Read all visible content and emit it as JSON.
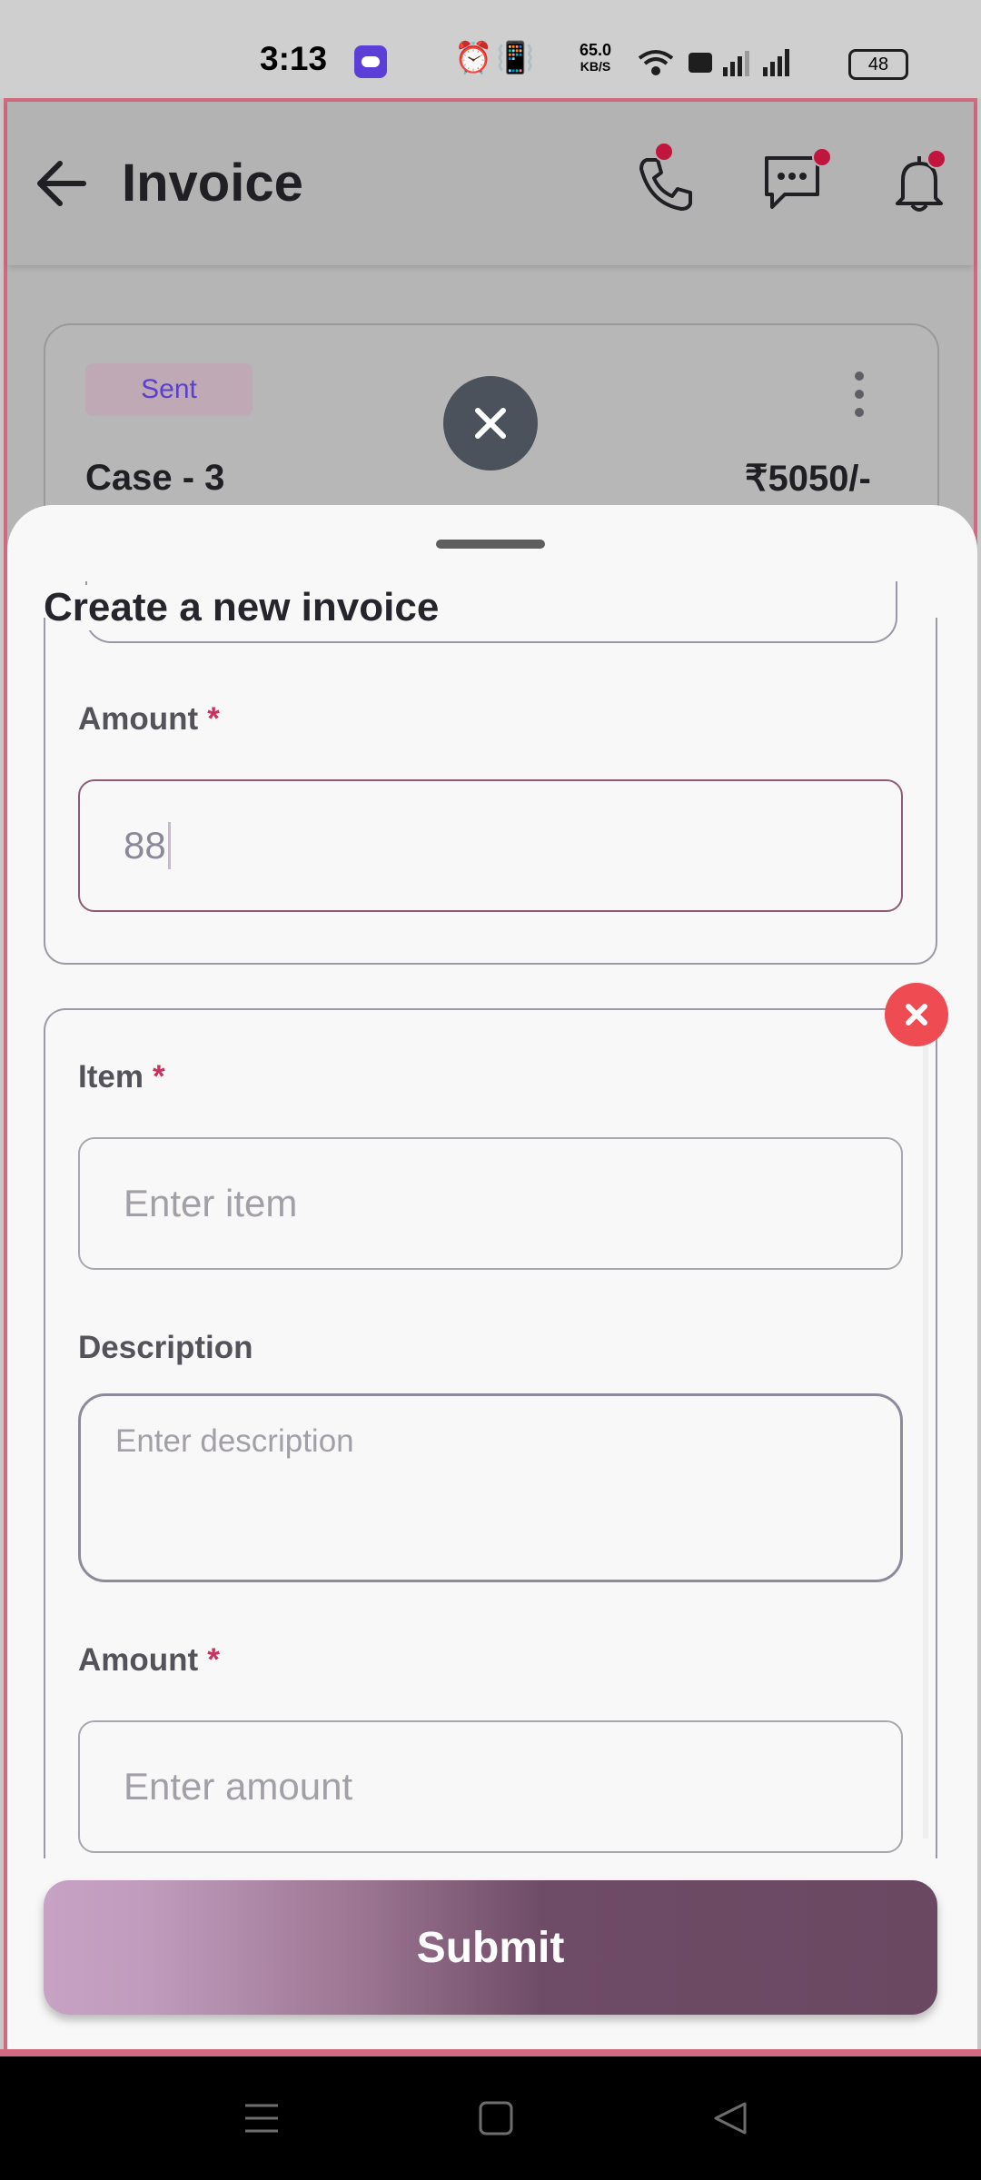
{
  "status_bar": {
    "time": "3:13",
    "speed_value": "65.0",
    "speed_unit": "KB/S",
    "battery": "48",
    "icons": [
      "alarm-icon",
      "vibrate-icon",
      "bluetooth-icon",
      "wifi-icon",
      "wifi-calling-icon",
      "signal-icon",
      "signal-icon"
    ]
  },
  "appbar": {
    "title": "Invoice",
    "icons": [
      "back-arrow-icon",
      "phone-icon",
      "chat-icon",
      "bell-icon"
    ]
  },
  "case_card": {
    "status": "Sent",
    "title": "Case - 3",
    "amount": "₹5050/-"
  },
  "sheet": {
    "title": "Create a new invoice",
    "group1": {
      "amount_label": "Amount",
      "required_mark": "*",
      "amount_value": "88"
    },
    "group2": {
      "item_label": "Item",
      "item_placeholder": "Enter item",
      "description_label": "Description",
      "description_placeholder": "Enter description",
      "amount_label": "Amount",
      "amount_placeholder": "Enter amount",
      "required_mark": "*"
    },
    "submit_label": "Submit"
  },
  "colors": {
    "accent": "#6a4862",
    "required": "#c8325f",
    "remove_button": "#ee4b52",
    "notification_dot": "#c1153d",
    "status_text": "#5a3fd0"
  }
}
